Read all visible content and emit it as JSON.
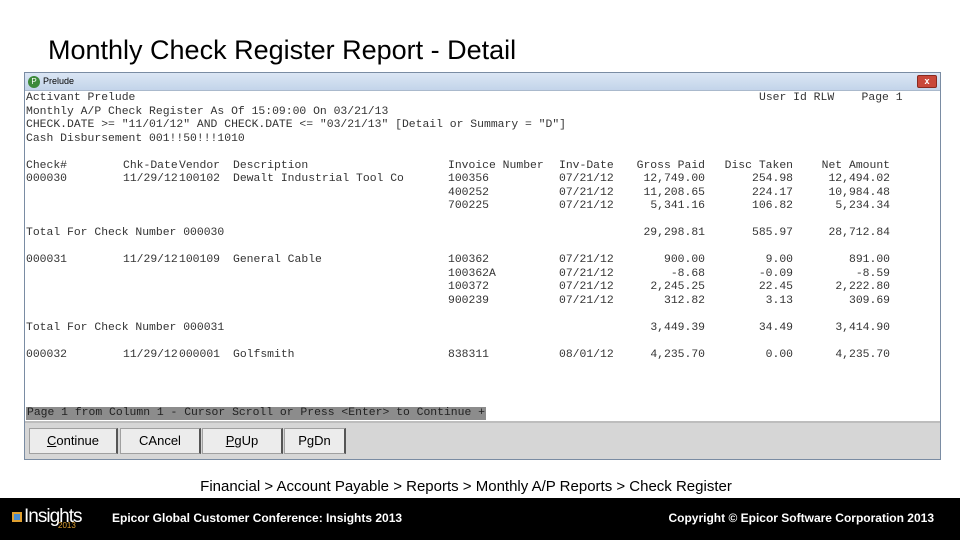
{
  "slide": {
    "title": "Monthly Check Register Report - Detail",
    "breadcrumb": "Financial > Account Payable > Reports > Monthly A/P Reports > Check Register"
  },
  "window": {
    "title": "Prelude",
    "close_label": "x"
  },
  "report": {
    "header_lines": [
      "Activant Prelude",
      "Monthly A/P Check Register As Of 15:09:00 On 03/21/13",
      "CHECK.DATE >= \"11/01/12\" AND CHECK.DATE <= \"03/21/13\" [Detail or Summary = \"D\"]",
      "Cash Disbursement 001!!50!!!1010"
    ],
    "user_page": "User Id RLW    Page 1",
    "columns": [
      "Check#",
      "Chk-Date",
      "Vendor",
      "Description",
      "Invoice Number",
      "Inv-Date",
      "Gross Paid",
      "Disc Taken",
      "Net Amount"
    ],
    "checks": [
      {
        "check": "000030",
        "date": "11/29/12",
        "vendor": "100102",
        "description": "Dewalt Industrial Tool Co",
        "invoices": [
          [
            "100356",
            "07/21/12",
            "12,749.00",
            "254.98",
            "12,494.02"
          ],
          [
            "400252",
            "07/21/12",
            "11,208.65",
            "224.17",
            "10,984.48"
          ],
          [
            "700225",
            "07/21/12",
            "5,341.16",
            "106.82",
            "5,234.34"
          ]
        ],
        "total_label": "Total For Check Number 000030",
        "total": [
          "29,298.81",
          "585.97",
          "28,712.84"
        ]
      },
      {
        "check": "000031",
        "date": "11/29/12",
        "vendor": "100109",
        "description": "General Cable",
        "invoices": [
          [
            "100362",
            "07/21/12",
            "900.00",
            "9.00",
            "891.00"
          ],
          [
            "100362A",
            "07/21/12",
            "-8.68",
            "-0.09",
            "-8.59"
          ],
          [
            "100372",
            "07/21/12",
            "2,245.25",
            "22.45",
            "2,222.80"
          ],
          [
            "900239",
            "07/21/12",
            "312.82",
            "3.13",
            "309.69"
          ]
        ],
        "total_label": "Total For Check Number 000031",
        "total": [
          "3,449.39",
          "34.49",
          "3,414.90"
        ]
      },
      {
        "check": "000032",
        "date": "11/29/12",
        "vendor": "000001",
        "description": "Golfsmith",
        "invoices": [
          [
            "838311",
            "08/01/12",
            "4,235.70",
            "0.00",
            "4,235.70"
          ]
        ]
      }
    ],
    "status": "Page 1 from Column 1 - Cursor Scroll or Press <Enter> to Continue +"
  },
  "buttons": [
    {
      "label": "Continue"
    },
    {
      "label": "CAncel"
    },
    {
      "label": "PgUp"
    },
    {
      "label": "PgDn"
    }
  ],
  "footer": {
    "logo": "Insights",
    "logo_year": "2013",
    "conference": "Epicor Global Customer Conference: Insights 2013",
    "copyright": "Copyright © Epicor Software Corporation 2013"
  }
}
